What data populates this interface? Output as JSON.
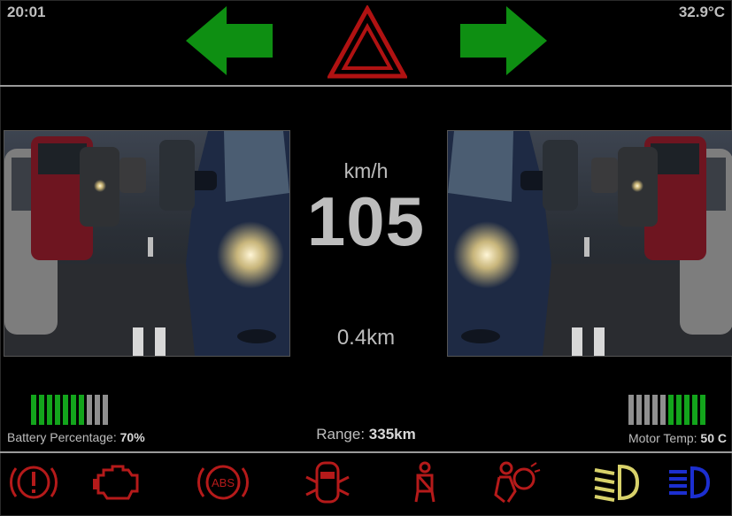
{
  "status": {
    "time": "20:01",
    "temperature": "32.9°C"
  },
  "indicators": {
    "left_arrow_icon": "arrow-left-icon",
    "right_arrow_icon": "arrow-right-icon",
    "hazard_icon": "hazard-triangle-icon",
    "arrow_color": "#0e8f12",
    "hazard_color": "#b01212"
  },
  "cameras": {
    "left": "left-camera-view",
    "right": "right-camera-view"
  },
  "speed": {
    "unit": "km/h",
    "value": "105"
  },
  "trip": {
    "distance": "0.4km"
  },
  "battery": {
    "label": "Battery Percentage: ",
    "value": "70%",
    "level": 0.7,
    "segments": 10,
    "filled": 7
  },
  "range": {
    "label": "Range: ",
    "value": "335km"
  },
  "motor_temp": {
    "label": "Motor Temp: ",
    "value": "50 C",
    "level": 0.5,
    "segments": 10,
    "filled": 5
  },
  "telltales": [
    {
      "icon": "brake-warning-icon",
      "color": "#b51a1a"
    },
    {
      "icon": "check-engine-icon",
      "color": "#b51a1a"
    },
    {
      "icon": "abs-icon",
      "color": "#b51a1a"
    },
    {
      "icon": "door-open-icon",
      "color": "#b51a1a"
    },
    {
      "icon": "seatbelt-icon",
      "color": "#b51a1a"
    },
    {
      "icon": "airbag-icon",
      "color": "#b51a1a"
    },
    {
      "icon": "low-beam-icon",
      "color": "#d8d26a"
    },
    {
      "icon": "high-beam-icon",
      "color": "#1c2fd0"
    }
  ],
  "abs_text": "ABS"
}
